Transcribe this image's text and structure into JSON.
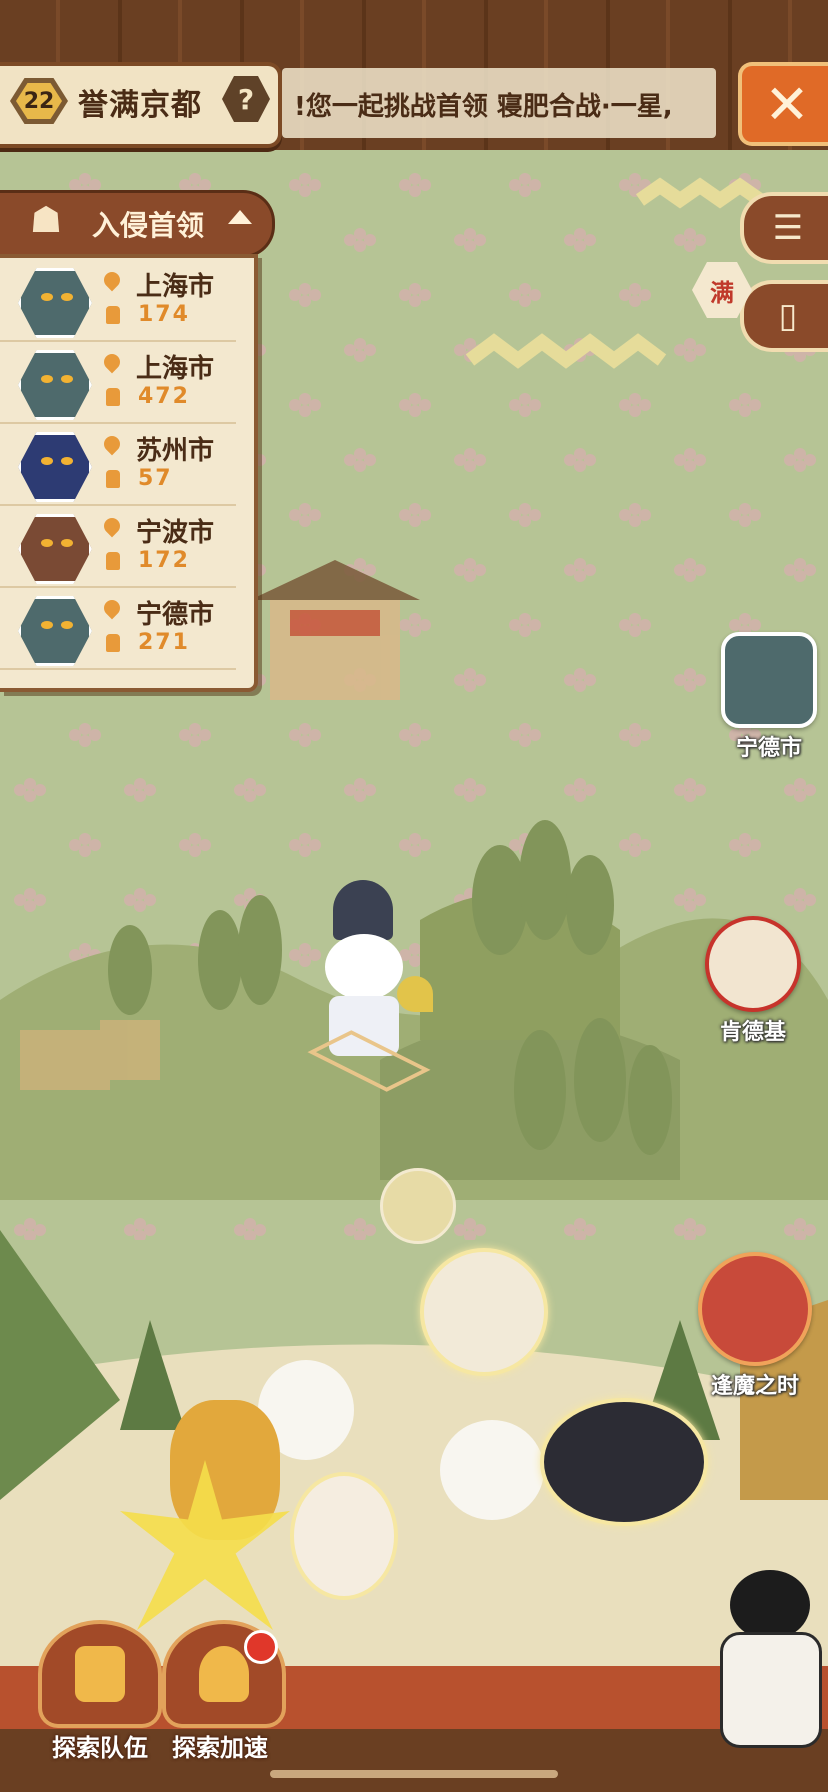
{
  "top_bar": {
    "level": "22",
    "region_name": "誉满京都",
    "help_label": "?",
    "ticker_text": "!您一起挑战首领 寝肥合战·一星,",
    "close_label": "✕"
  },
  "boss_panel": {
    "title": "入侵首领",
    "items": [
      {
        "city": "上海市",
        "count": "174",
        "avatar_color": "#4e6a6c"
      },
      {
        "city": "上海市",
        "count": "472",
        "avatar_color": "#4e6a6c"
      },
      {
        "city": "苏州市",
        "count": "57",
        "avatar_color": "#2d3b73"
      },
      {
        "city": "宁波市",
        "count": "172",
        "avatar_color": "#7a4a34"
      },
      {
        "city": "宁德市",
        "count": "271",
        "avatar_color": "#4e6a6c"
      }
    ]
  },
  "side_buttons": {
    "menu_icon": "list-icon",
    "card_icon": "card-icon",
    "full_badge": "满"
  },
  "map_markers": {
    "ningde": "宁德市",
    "kfc": "肯德基",
    "demon_time": "逢魔之时"
  },
  "bottom": {
    "team_label": "探索队伍",
    "speed_label": "探索加速"
  },
  "colors": {
    "accent": "#e06a27",
    "wood": "#6a3f22",
    "panel": "#f3e8cf",
    "count": "#e08a2a"
  }
}
